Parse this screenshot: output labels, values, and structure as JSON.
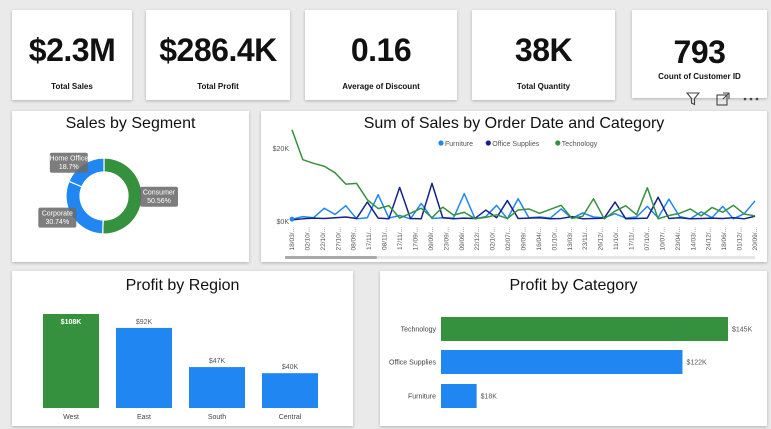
{
  "kpis": [
    {
      "value": "$2.3M",
      "label": "Total Sales"
    },
    {
      "value": "$286.4K",
      "label": "Total Profit"
    },
    {
      "value": "0.16",
      "label": "Average of Discount"
    },
    {
      "value": "38K",
      "label": "Total Quantity"
    },
    {
      "value": "793",
      "label": "Count of Customer ID"
    }
  ],
  "colors": {
    "green": "#36913f",
    "blue": "#1f86f2",
    "navy": "#13238b"
  },
  "icons": [
    "filter-icon",
    "focus-mode-icon",
    "more-options-icon"
  ],
  "chart_data": [
    {
      "type": "pie",
      "title": "Sales by Segment",
      "slices": [
        {
          "name": "Consumer",
          "value": 50.56,
          "label": "50.56%",
          "color": "#36913f"
        },
        {
          "name": "Corporate",
          "value": 30.74,
          "label": "30.74%",
          "color": "#1f86f2"
        },
        {
          "name": "Home Office",
          "value": 18.7,
          "label": "18.7%",
          "color": "#1f86f2"
        }
      ]
    },
    {
      "type": "line",
      "title": "Sum of Sales by Order Date and Category",
      "legend": "top",
      "y_ticks": [
        "$20K",
        "$0K"
      ],
      "ylim": [
        0,
        20000
      ],
      "x": [
        "18/03/...",
        "02/10/...",
        "22/10/...",
        "27/10/...",
        "08/09/...",
        "17/11/...",
        "08/11/...",
        "17/11/...",
        "17/09/...",
        "09/09/...",
        "23/09/...",
        "09/09/...",
        "22/12/...",
        "02/10/...",
        "02/07/...",
        "09/09/...",
        "16/04/...",
        "01/10/...",
        "13/03/...",
        "23/11/...",
        "26/12/...",
        "11/10/...",
        "17/11/...",
        "07/10/...",
        "10/07/...",
        "23/04/...",
        "14/03/...",
        "24/12/...",
        "18/06/...",
        "01/12/...",
        "20/09/..."
      ],
      "series": [
        {
          "name": "Furniture",
          "color": "#1f86f2",
          "values": [
            500,
            1200,
            900,
            3500,
            1800,
            4200,
            600,
            900,
            7200,
            800,
            1500,
            600,
            4800,
            700,
            900,
            800,
            7500,
            600,
            1200,
            4300,
            600,
            6100,
            900,
            1100,
            800,
            3300,
            700,
            2200,
            1100,
            900,
            2000,
            800,
            1100,
            4000,
            900,
            6000,
            1200,
            600,
            2500,
            900,
            4000,
            600,
            2000,
            5500
          ]
        },
        {
          "name": "Office Supplies",
          "color": "#13238b",
          "values": [
            300,
            600,
            800,
            700,
            900,
            1100,
            700,
            5200,
            800,
            600,
            9200,
            700,
            600,
            10300,
            900,
            600,
            800,
            700,
            3000,
            900,
            5600,
            700,
            800,
            900,
            600,
            700,
            1200,
            600,
            700,
            800,
            5200,
            600,
            700,
            800,
            6500,
            700,
            900,
            600,
            700,
            800,
            700,
            900,
            600,
            1300
          ]
        },
        {
          "name": "Technology",
          "color": "#36913f",
          "values": [
            25000,
            16800,
            15800,
            15000,
            13200,
            10100,
            10300,
            5800,
            3400,
            4200,
            800,
            2100,
            3500,
            900,
            3800,
            1600,
            2400,
            600,
            1000,
            1700,
            700,
            3000,
            3300,
            2100,
            3200,
            4300,
            700,
            1300,
            6100,
            600,
            2700,
            4200,
            1700,
            9100,
            600,
            1500,
            2100,
            3300,
            1400,
            3700,
            2400,
            4300,
            1900,
            1400
          ]
        }
      ]
    },
    {
      "type": "bar",
      "title": "Profit by Region",
      "categories": [
        "West",
        "East",
        "South",
        "Central"
      ],
      "values": [
        108000,
        92000,
        47000,
        40000
      ],
      "labels": [
        "$108K",
        "$92K",
        "$47K",
        "$40K"
      ],
      "colors": [
        "#36913f",
        "#1f86f2",
        "#1f86f2",
        "#1f86f2"
      ],
      "ylim": [
        0,
        108000
      ]
    },
    {
      "type": "bar",
      "orientation": "horizontal",
      "title": "Profit by Category",
      "categories": [
        "Technology",
        "Office Supplies",
        "Furniture"
      ],
      "values": [
        145000,
        122000,
        18000
      ],
      "labels": [
        "$145K",
        "$122K",
        "$18K"
      ],
      "colors": [
        "#36913f",
        "#1f86f2",
        "#1f86f2"
      ],
      "xlim": [
        0,
        145000
      ]
    }
  ]
}
